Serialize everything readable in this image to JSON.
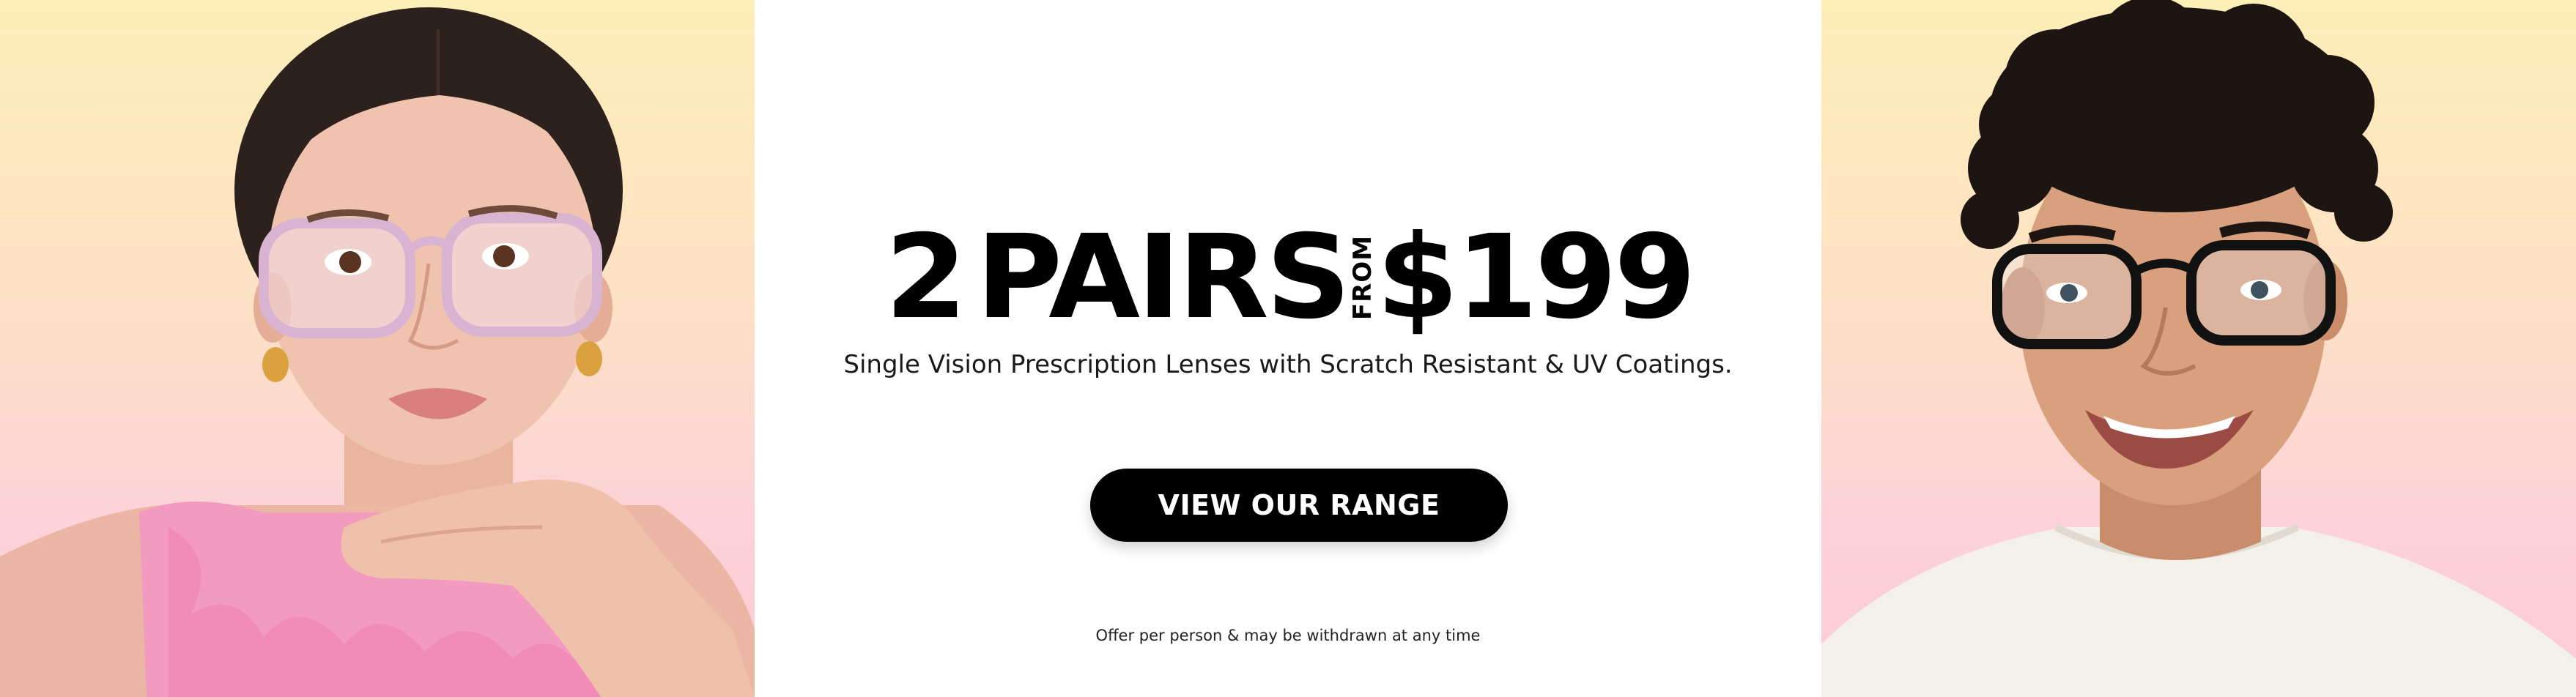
{
  "promo": {
    "headline_count": "2",
    "headline_unit": "PAIRS",
    "headline_from": "FROM",
    "headline_price": "$199",
    "subtitle": "Single Vision Prescription Lenses with Scratch Resistant & UV Coatings.",
    "cta_label": "VIEW OUR RANGE",
    "disclaimer": "Offer per person & may be withdrawn at any time"
  },
  "colors": {
    "cta_background": "#000000",
    "cta_text": "#ffffff",
    "panel_gradient_top": "#fdefb8",
    "panel_gradient_bottom": "#fccbd6",
    "left_top_pink": "#f7a1c4"
  },
  "images": {
    "left": "woman-wearing-pink-frame-glasses-photo",
    "right": "smiling-man-wearing-black-frame-glasses-photo"
  }
}
